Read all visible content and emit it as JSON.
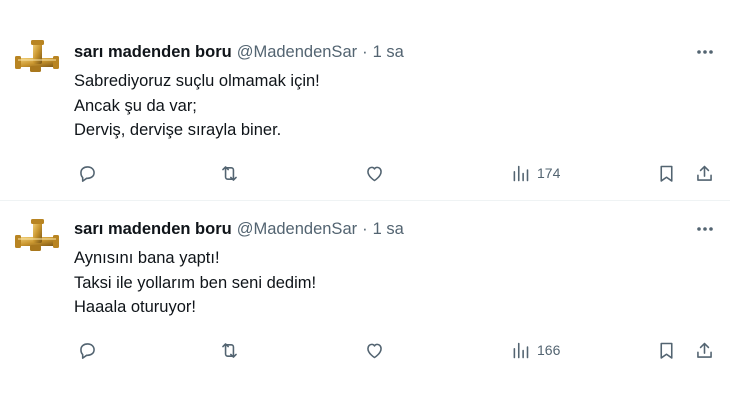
{
  "tweets": [
    {
      "author_name": "sarı madenden boru",
      "handle": "@MadendenSar",
      "separator": "·",
      "time": "1 sa",
      "lines": [
        "Sabrediyoruz suçlu olmamak için!",
        "Ancak şu da var;",
        "Derviş, dervişe sırayla biner."
      ],
      "views": "174",
      "avatar_icon": "brass-pipe-fitting-avatar"
    },
    {
      "author_name": "sarı madenden boru",
      "handle": "@MadendenSar",
      "separator": "·",
      "time": "1 sa",
      "lines": [
        "Aynısını bana yaptı!",
        "Taksi ile yollarım ben seni dedim!",
        "Haaala oturuyor!"
      ],
      "views": "166",
      "avatar_icon": "brass-pipe-fitting-avatar"
    }
  ],
  "icons": [
    "more-icon",
    "reply-icon",
    "retweet-icon",
    "like-icon",
    "views-icon",
    "bookmark-icon",
    "share-icon"
  ],
  "colors": {
    "text": "#0f1419",
    "secondary": "#536471",
    "divider": "#eff3f4",
    "brass": "#c9962f"
  }
}
